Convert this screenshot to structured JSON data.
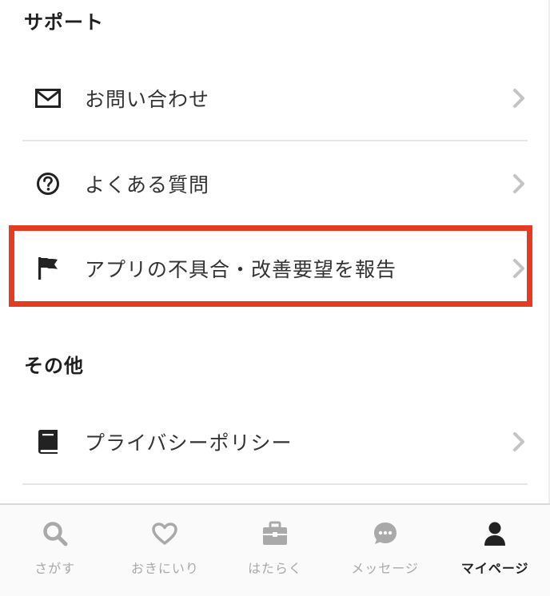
{
  "sections": {
    "support": {
      "title": "サポート",
      "items": [
        {
          "label": "お問い合わせ",
          "icon": "envelope-icon"
        },
        {
          "label": "よくある質問",
          "icon": "question-circle-icon"
        },
        {
          "label": "アプリの不具合・改善要望を報告",
          "icon": "flag-icon"
        }
      ]
    },
    "other": {
      "title": "その他",
      "items": [
        {
          "label": "プライバシーポリシー",
          "icon": "book-icon"
        }
      ]
    }
  },
  "highlight_color": "#e63a22",
  "tabbar": {
    "tabs": [
      {
        "label": "さがす",
        "icon": "search-icon",
        "active": false
      },
      {
        "label": "おきにいり",
        "icon": "heart-icon",
        "active": false
      },
      {
        "label": "はたらく",
        "icon": "briefcase-icon",
        "active": false
      },
      {
        "label": "メッセージ",
        "icon": "chat-bubble-icon",
        "active": false
      },
      {
        "label": "マイページ",
        "icon": "person-icon",
        "active": true
      }
    ]
  }
}
